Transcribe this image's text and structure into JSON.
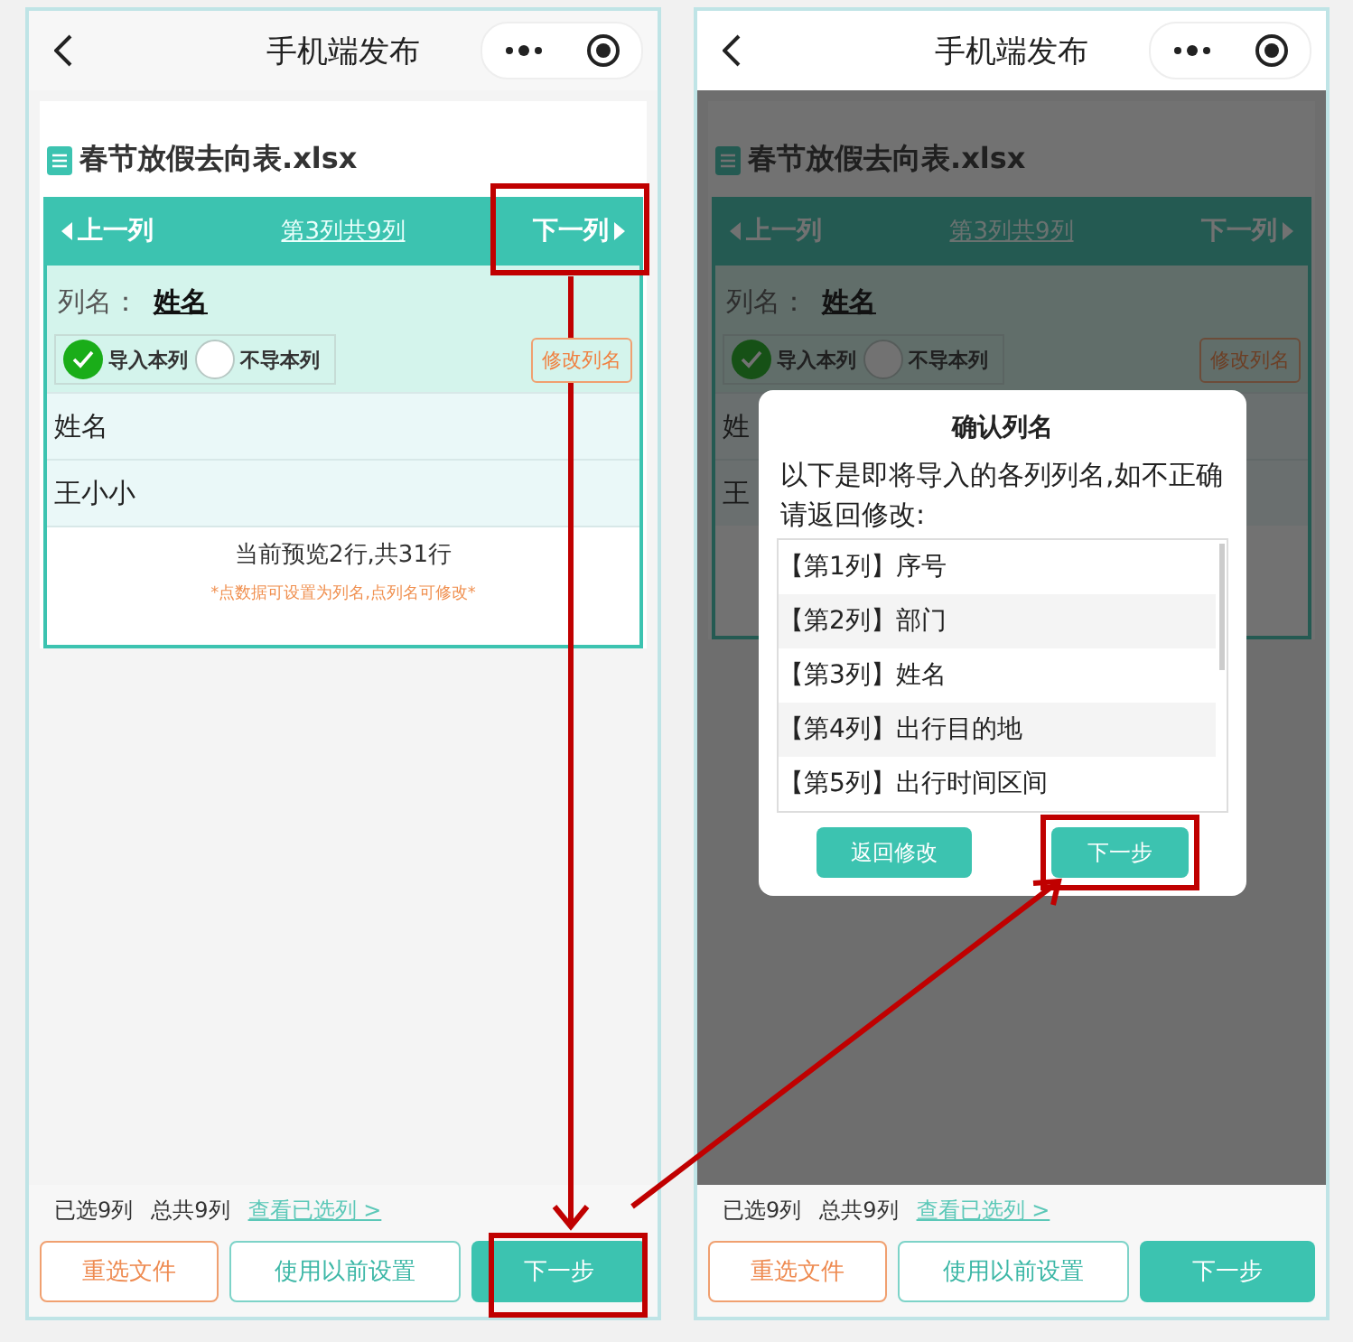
{
  "screens": [
    {
      "nav": {
        "title": "手机端发布"
      },
      "dimmed": false,
      "file": {
        "name": "春节放假去向表.xlsx"
      },
      "column_nav": {
        "prev": "上一列",
        "position": "第3列共9列",
        "next": "下一列"
      },
      "column_name": {
        "label": "列名：",
        "value": "姓名"
      },
      "options": [
        {
          "label": "导入本列",
          "selected": true
        },
        {
          "label": "不导本列",
          "selected": false
        }
      ],
      "rename_button": "修改列名",
      "rows": [
        "姓名",
        "王小小"
      ],
      "preview": {
        "summary": "当前预览2行,共31行",
        "hint": "*点数据可设置为列名,点列名可修改*"
      },
      "footer": {
        "selected": "已选9列",
        "total": "总共9列",
        "link": "查看已选列 >"
      },
      "buttons": [
        {
          "label": "重选文件",
          "kind": "warning"
        },
        {
          "label": "使用以前设置",
          "kind": "outline"
        },
        {
          "label": "下一步",
          "kind": "primary"
        }
      ]
    },
    {
      "nav": {
        "title": "手机端发布"
      },
      "dimmed": true,
      "file": {
        "name": "春节放假去向表.xlsx"
      },
      "column_nav": {
        "prev": "上一列",
        "position": "第3列共9列",
        "next": "下一列"
      },
      "column_name": {
        "label": "列名：",
        "value": "姓名"
      },
      "options": [
        {
          "label": "导入本列",
          "selected": true
        },
        {
          "label": "不导本列",
          "selected": false
        }
      ],
      "rename_button": "修改列名",
      "rows": [
        "姓",
        "王"
      ],
      "dialog": {
        "title": "确认列名",
        "message": "以下是即将导入的各列列名,如不正确请返回修改:",
        "items": [
          "【第1列】序号",
          "【第2列】部门",
          "【第3列】姓名",
          "【第4列】出行目的地",
          "【第5列】出行时间区间"
        ],
        "buttons": [
          {
            "label": "返回修改",
            "kind": "secondary"
          },
          {
            "label": "下一步",
            "kind": "primary"
          }
        ]
      },
      "footer": {
        "selected": "已选9列",
        "total": "总共9列",
        "link": "查看已选列 >"
      },
      "buttons": [
        {
          "label": "重选文件",
          "kind": "warning"
        },
        {
          "label": "使用以前设置",
          "kind": "outline"
        },
        {
          "label": "下一步",
          "kind": "primary"
        }
      ]
    }
  ]
}
